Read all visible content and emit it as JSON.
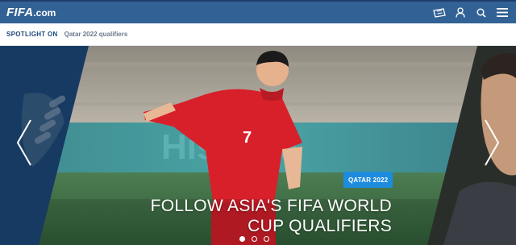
{
  "header": {
    "logo_text": "FIFA",
    "logo_domain": ".com",
    "bg_color": "#326295",
    "icons": [
      "ticket-icon",
      "user-icon",
      "search-icon",
      "menu-icon"
    ]
  },
  "spotlight": {
    "label": "SPOTLIGHT ON",
    "item": "Qatar 2022 qualifiers"
  },
  "hero": {
    "badge": "QATAR 2022",
    "headline_line1": "FOLLOW ASIA'S FIFA WORLD",
    "headline_line2": "CUP QUALIFIERS",
    "player_number": "7",
    "badge_color": "#1e8cde",
    "slides_total": 3,
    "active_slide": 1
  }
}
